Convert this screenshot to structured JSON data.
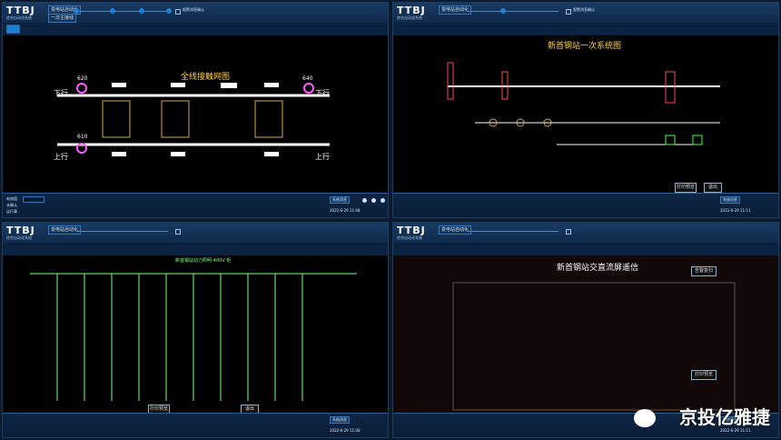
{
  "brand": {
    "logo": "TTBJ",
    "logo_sub": "综合自动化系统"
  },
  "header": {
    "left_box1": "变电站自动化",
    "left_box2": "一次主接线",
    "check_label": "报警消息确认"
  },
  "panels": [
    {
      "title": "全线接触网图",
      "labels": {
        "down_left": "下行",
        "down_right": "下行",
        "up_left": "上行",
        "up_right": "上行",
        "n620": "620",
        "n640": "640",
        "n610": "610"
      }
    },
    {
      "title": "新首钢站一次系统图",
      "buttons": {
        "print": "打印预览",
        "exit": "退出"
      }
    },
    {
      "title": "新首钢站动力照明-400V 柜",
      "buttons": {
        "print": "打印预览",
        "exit": "退出"
      }
    },
    {
      "title": "新首钢站交直流屏遥信",
      "buttons": {
        "print": "打印预览",
        "alarm": "告警复归"
      }
    }
  ],
  "footer": {
    "label1": "有效值",
    "label2": "未确认",
    "label3": "运行事",
    "val1": "2202",
    "val2": "2206",
    "ok": "正常",
    "btn": "系统消息",
    "date1": "2022-6-29 11:08",
    "date2": "2022-6-29 11:11"
  },
  "watermark": "京投亿雅捷"
}
